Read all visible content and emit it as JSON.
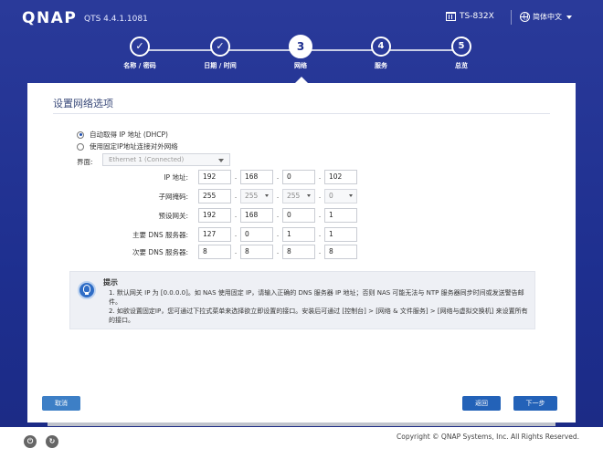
{
  "header": {
    "brand": "QNAP",
    "version": "QTS 4.4.1.1081",
    "model": "TS-832X",
    "language": "简体中文"
  },
  "stepper": {
    "steps": [
      {
        "number": "✓",
        "label": "名称 / 密码",
        "state": "done"
      },
      {
        "number": "✓",
        "label": "日期 / 时间",
        "state": "done"
      },
      {
        "number": "3",
        "label": "网络",
        "state": "active"
      },
      {
        "number": "4",
        "label": "服务",
        "state": "pending"
      },
      {
        "number": "5",
        "label": "总览",
        "state": "pending"
      }
    ]
  },
  "panel": {
    "title": "设置网络选项",
    "options": {
      "dhcp": "自动取得 IP 地址 (DHCP)",
      "static": "使用固定IP地址连接对外网络",
      "selected": "dhcp"
    },
    "interface": {
      "label": "界面:",
      "value": "Ethernet 1 (Connected)"
    },
    "fields": {
      "ip": {
        "label": "IP 地址:",
        "octets": [
          "192",
          "168",
          "0",
          "102"
        ]
      },
      "mask": {
        "label": "子网掩码:",
        "octets": [
          "255",
          "255",
          "255",
          "0"
        ]
      },
      "gateway": {
        "label": "预设网关:",
        "octets": [
          "192",
          "168",
          "0",
          "1"
        ]
      },
      "dns1": {
        "label": "主要 DNS 服务器:",
        "octets": [
          "127",
          "0",
          "1",
          "1"
        ]
      },
      "dns2": {
        "label": "次要 DNS 服务器:",
        "octets": [
          "8",
          "8",
          "8",
          "8"
        ]
      }
    },
    "tip": {
      "title": "提示",
      "item1": "1. 默认网关 IP 为 [0.0.0.0]。如 NAS 使用固定 IP，请输入正确的 DNS 服务器 IP 地址；否则 NAS 可能无法与 NTP 服务器同步时间或发送警告邮件。",
      "item2": "2. 如欲设置固定IP，您可通过下拉式菜单来选择欲立即设置的接口。安装后可通过 [控制台] > [网络 & 文件服务] > [网络与虚拟交换机] 来设置所有的接口。"
    },
    "buttons": {
      "cancel": "取消",
      "back": "返回",
      "next": "下一步"
    }
  },
  "footer": {
    "copyright": "Copyright © QNAP Systems, Inc. All Rights Reserved."
  }
}
